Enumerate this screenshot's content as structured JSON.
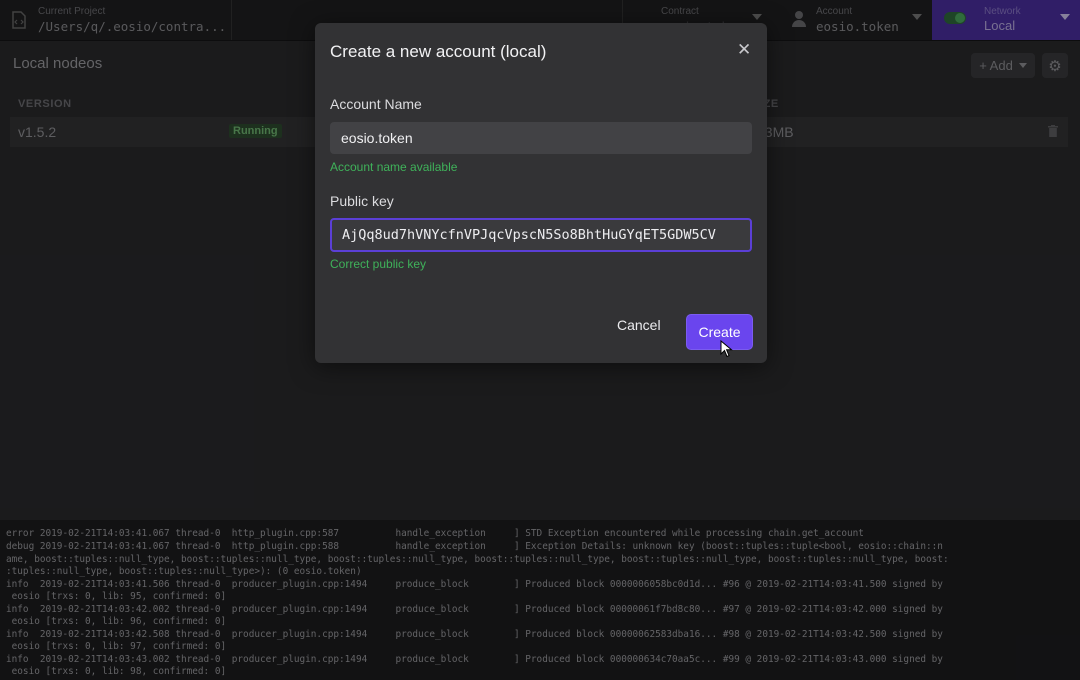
{
  "topbar": {
    "project": {
      "label": "Current Project",
      "value": "/Users/q/.eosio/contra..."
    },
    "contract": {
      "label": "Contract",
      "value": "eosio.token"
    },
    "account": {
      "label": "Account",
      "value": "eosio.token"
    },
    "network": {
      "label": "Network",
      "value": "Local"
    }
  },
  "panel": {
    "title": "Local nodeos",
    "add_label": "+ Add",
    "columns": {
      "version": "VERSION",
      "size": "SIZE"
    },
    "row": {
      "version": "v1.5.2",
      "status": "Running",
      "size": "23MB"
    }
  },
  "modal": {
    "title": "Create a new account (local)",
    "account_name_label": "Account Name",
    "account_name_value": "eosio.token",
    "account_name_help": "Account name available",
    "public_key_label": "Public key",
    "public_key_value": "AjQq8ud7hVNYcfnVPJqcVpscN5So8BhtHuGYqET5GDW5CV",
    "public_key_help": "Correct public key",
    "cancel_label": "Cancel",
    "create_label": "Create"
  },
  "logs": [
    "error 2019-02-21T14:03:41.067 thread-0  http_plugin.cpp:587          handle_exception     ] STD Exception encountered while processing chain.get_account",
    "debug 2019-02-21T14:03:41.067 thread-0  http_plugin.cpp:588          handle_exception     ] Exception Details: unknown key (boost::tuples::tuple<bool, eosio::chain::n",
    "ame, boost::tuples::null_type, boost::tuples::null_type, boost::tuples::null_type, boost::tuples::null_type, boost::tuples::null_type, boost::tuples::null_type, boost:",
    ":tuples::null_type, boost::tuples::null_type>): (0 eosio.token)",
    "info  2019-02-21T14:03:41.506 thread-0  producer_plugin.cpp:1494     produce_block        ] Produced block 0000006058bc0d1d... #96 @ 2019-02-21T14:03:41.500 signed by",
    " eosio [trxs: 0, lib: 95, confirmed: 0]",
    "info  2019-02-21T14:03:42.002 thread-0  producer_plugin.cpp:1494     produce_block        ] Produced block 00000061f7bd8c80... #97 @ 2019-02-21T14:03:42.000 signed by",
    " eosio [trxs: 0, lib: 96, confirmed: 0]",
    "info  2019-02-21T14:03:42.508 thread-0  producer_plugin.cpp:1494     produce_block        ] Produced block 00000062583dba16... #98 @ 2019-02-21T14:03:42.500 signed by",
    " eosio [trxs: 0, lib: 97, confirmed: 0]",
    "info  2019-02-21T14:03:43.002 thread-0  producer_plugin.cpp:1494     produce_block        ] Produced block 000000634c70aa5c... #99 @ 2019-02-21T14:03:43.000 signed by",
    " eosio [trxs: 0, lib: 98, confirmed: 0]"
  ],
  "colors": {
    "accent": "#6a45ee",
    "network_bg": "#4a2f9e",
    "success": "#3fb25a",
    "running_badge": "#2d4a2f"
  },
  "icons": [
    "file-code-icon",
    "user-icon",
    "toggle-icon",
    "gear-icon",
    "trash-icon",
    "close-icon",
    "cursor-icon",
    "chevron-down-icon"
  ]
}
